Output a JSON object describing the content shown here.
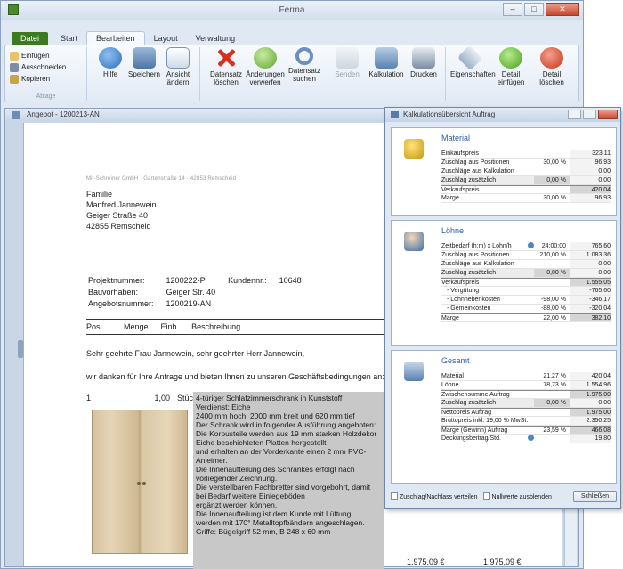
{
  "window": {
    "title": "Ferma"
  },
  "ribbon": {
    "tabs": [
      {
        "label": "Datei"
      },
      {
        "label": "Start"
      },
      {
        "label": "Bearbeiten"
      },
      {
        "label": "Layout"
      },
      {
        "label": "Verwaltung"
      }
    ],
    "clipboard": {
      "paste": "Einfügen",
      "cut": "Ausschneiden",
      "copy": "Kopieren",
      "group": "Ablage"
    },
    "buttons": {
      "help": "Hilfe",
      "save": "Speichern",
      "view": "Ansicht ändern",
      "delete": "Datensatz löschen",
      "discard": "Änderungen verwerfen",
      "search": "Datensatz suchen",
      "send": "Senden",
      "calc": "Kalkulation",
      "print": "Drucken",
      "props": "Eigenschaften",
      "insert": "Detail einfügen",
      "remove": "Detail löschen"
    }
  },
  "document": {
    "title": "Angebot - 1200213-AN",
    "sender": "Mit-Schreiner GmbH · Gartenstraße 14 · 42853 Remscheid",
    "address": [
      "Familie",
      "Manfred Jannewein",
      "Geiger Straße 40",
      "42855 Remscheid"
    ],
    "meta": [
      {
        "label": "Projektnummer:",
        "value": "1200222-P",
        "label2": "Kundennr.:",
        "value2": "10648"
      },
      {
        "label": "Bauvorhaben:",
        "value": "Geiger Str. 40",
        "label2": "",
        "value2": ""
      },
      {
        "label": "Angebotsnummer:",
        "value": "1200219-AN",
        "label2": "",
        "value2": ""
      }
    ],
    "columns": [
      "Pos.",
      "Menge",
      "Einh.",
      "Beschreibung"
    ],
    "salutation": "Sehr geehrte Frau Jannewein, sehr geehrter Herr Jannewein,",
    "intro": "wir danken für Ihre Anfrage und bieten Ihnen zu unseren Geschäftsbedingungen an:",
    "position": {
      "num": "1",
      "qty": "1,00",
      "unit": "Stück"
    },
    "description": [
      "4-türiger Schlafzimmerschrank in Kunststoff",
      "Verdienst: Eiche",
      "2400 mm hoch, 2000 mm breit und 620 mm tief",
      "Der Schrank wird in folgender Ausführung angeboten:",
      "Die Korpusteile werden aus 19 mm starken Holzdekor Eiche beschichteten Platten hergestellt",
      "und erhalten an der Vorderkante einen 2 mm PVC-Anleimer.",
      "Die Innenaufteilung des Schrankes erfolgt nach vorliegender Zeichnung.",
      "Die verstellbaren Fachbretter sind vorgebohrt, damit bei Bedarf weitere Einlegeböden",
      "ergänzt werden können.",
      "Die Innenaufteilung ist dem Kunde mit Lüftung",
      "werden mit 170° Metalltopfbändern angeschlagen.",
      "Griffe: Bügelgriff 52 mm, B 248 x 60 mm"
    ],
    "unit_price": "1.975,09 €",
    "total_price": "1.975,09 €"
  },
  "dialog": {
    "title": "Kalkulationsübersicht Auftrag",
    "material": {
      "title": "Material",
      "rows": [
        {
          "label": "Einkaufspreis",
          "pct": "",
          "value": "323,11",
          "style": ""
        },
        {
          "label": "Zuschlag aus Positionen",
          "pct": "30,00 %",
          "value": "96,93",
          "style": ""
        },
        {
          "label": "Zuschläge aus Kalkulation",
          "pct": "",
          "value": "0,00",
          "style": ""
        },
        {
          "label": "Zuschlag zusätzlich",
          "pct": "0,00 %",
          "value": "0,00",
          "style": "hl"
        },
        {
          "label": "Verkaufspreis",
          "pct": "",
          "value": "420,04",
          "style": "sum"
        },
        {
          "label": "Marge",
          "pct": "30,00 %",
          "value": "96,93",
          "style": ""
        }
      ]
    },
    "labor": {
      "title": "Löhne",
      "rows": [
        {
          "label": "Zeitbedarf (h:m) x Lohn/h",
          "pct": "24:00:00",
          "value": "765,60",
          "style": "info"
        },
        {
          "label": "Zuschlag aus Positionen",
          "pct": "210,00 %",
          "value": "1.083,36",
          "style": ""
        },
        {
          "label": "Zuschläge aus Kalkulation",
          "pct": "",
          "value": "0,00",
          "style": ""
        },
        {
          "label": "Zuschlag zusätzlich",
          "pct": "0,00 %",
          "value": "0,00",
          "style": "hl"
        },
        {
          "label": "Verkaufspreis",
          "pct": "",
          "value": "1.555,05",
          "style": "sum"
        },
        {
          "label": "- Vergütung",
          "pct": "",
          "value": "-765,60",
          "style": "sub"
        },
        {
          "label": "- Lohnnebenkosten",
          "pct": "-98,00 %",
          "value": "-346,17",
          "style": "sub"
        },
        {
          "label": "- Gemeinkosten",
          "pct": "-88,00 %",
          "value": "-320,04",
          "style": "sub"
        },
        {
          "label": "Marge",
          "pct": "22,00 %",
          "value": "382,10",
          "style": "sum"
        }
      ]
    },
    "totals": {
      "title": "Gesamt",
      "rows": [
        {
          "label": "Material",
          "pct": "21,27 %",
          "value": "420,04",
          "style": ""
        },
        {
          "label": "Löhne",
          "pct": "78,73 %",
          "value": "1.554,96",
          "style": ""
        },
        {
          "label": "Zwischensumme Auftrag",
          "pct": "",
          "value": "1.975,00",
          "style": "sum"
        },
        {
          "label": "Zuschlag zusätzlich",
          "pct": "0,00 %",
          "value": "0,00",
          "style": "hl"
        },
        {
          "label": "Nettopreis Auftrag",
          "pct": "",
          "value": "1.975,00",
          "style": "sum"
        },
        {
          "label": "Bruttopreis inkl. 19,00 % MwSt.",
          "pct": "",
          "value": "2.350,25",
          "style": ""
        },
        {
          "label": "Marge (Gewinn) Auftrag",
          "pct": "23,59 %",
          "value": "466,08",
          "style": "sum"
        },
        {
          "label": "Deckungsbeitrag/Std.",
          "pct": "",
          "value": "19,80",
          "style": "info"
        }
      ]
    },
    "footer": {
      "cb1": "Zuschlag/Nachlass verteilen",
      "cb2": "Nullwerte ausblenden",
      "close": "Schließen"
    }
  }
}
